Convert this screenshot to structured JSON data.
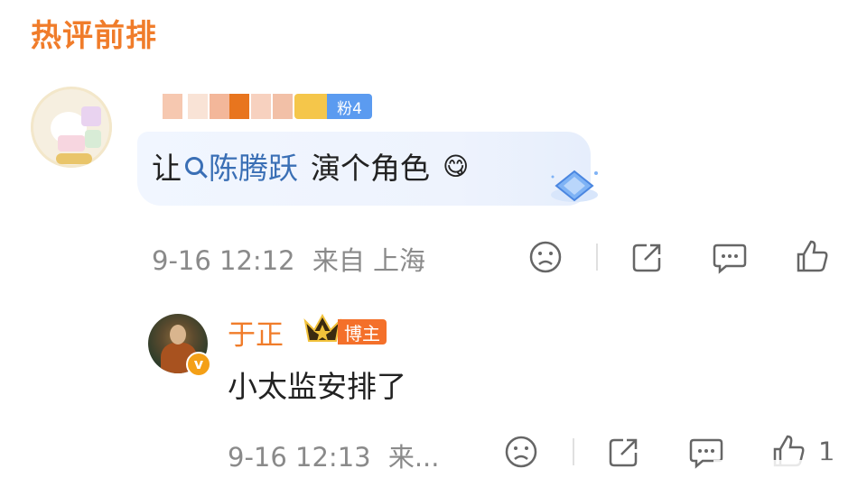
{
  "section": {
    "title": "热评前排"
  },
  "comment": {
    "username": "",
    "fan_badge": {
      "label": "粉4",
      "level": "4"
    },
    "text_prefix": "让",
    "mention": "陈腾跃",
    "text_suffix": "演个角色",
    "emoji": "😋",
    "time": "9-16 12:12",
    "location": "来自 上海",
    "actions": [
      "dislike-icon",
      "share-icon",
      "comment-icon",
      "like-icon"
    ]
  },
  "reply": {
    "username": "于正",
    "badge": "博主",
    "text": "小太监安排了",
    "time": "9-16 12:13",
    "location": "来...",
    "like_count": "1",
    "actions": [
      "dislike-icon",
      "share-icon",
      "comment-icon",
      "like-icon"
    ]
  },
  "colors": {
    "accent_orange": "#f07c2a",
    "mention_blue": "#3a6fb5",
    "meta_gray": "#8a8a8a",
    "bubble_blue": "#eef3fd"
  }
}
